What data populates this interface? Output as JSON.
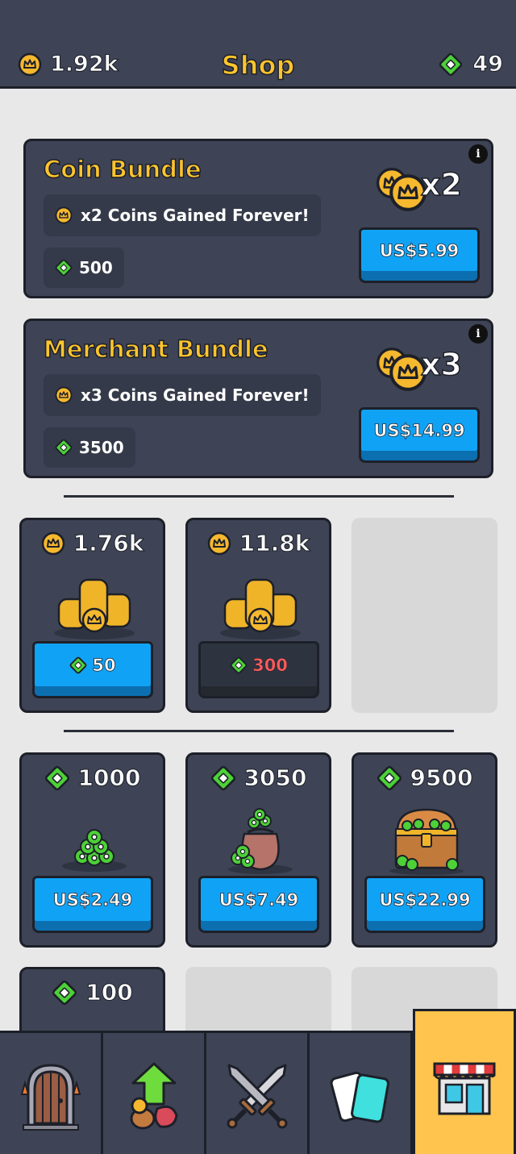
{
  "header": {
    "coins": "1.92k",
    "title": "Shop",
    "gems": "49"
  },
  "bundles": [
    {
      "title": "Coin Bundle",
      "description": "x2 Coins Gained Forever!",
      "gem_bonus": "500",
      "multiplier": "x2",
      "price": "US$5.99",
      "info": "i"
    },
    {
      "title": "Merchant Bundle",
      "description": "x3 Coins Gained Forever!",
      "gem_bonus": "3500",
      "multiplier": "x3",
      "price": "US$14.99",
      "info": "i"
    }
  ],
  "coin_offers": [
    {
      "amount": "1.76k",
      "cost": "50",
      "affordable": true
    },
    {
      "amount": "11.8k",
      "cost": "300",
      "affordable": false
    }
  ],
  "gem_offers": [
    {
      "amount": "1000",
      "price": "US$2.49"
    },
    {
      "amount": "3050",
      "price": "US$7.49"
    },
    {
      "amount": "9500",
      "price": "US$22.99"
    },
    {
      "amount": "100"
    }
  ],
  "nav": {
    "items": [
      {
        "name": "door-icon"
      },
      {
        "name": "upgrade-icon"
      },
      {
        "name": "crossed-swords-icon"
      },
      {
        "name": "cards-icon"
      },
      {
        "name": "shop-icon",
        "active": true
      }
    ]
  },
  "colors": {
    "panel": "#3e4455",
    "accent_gold": "#ffc52e",
    "button_blue": "#10a3f5",
    "gem_green": "#4cd137",
    "nav_active": "#ffc44d"
  }
}
